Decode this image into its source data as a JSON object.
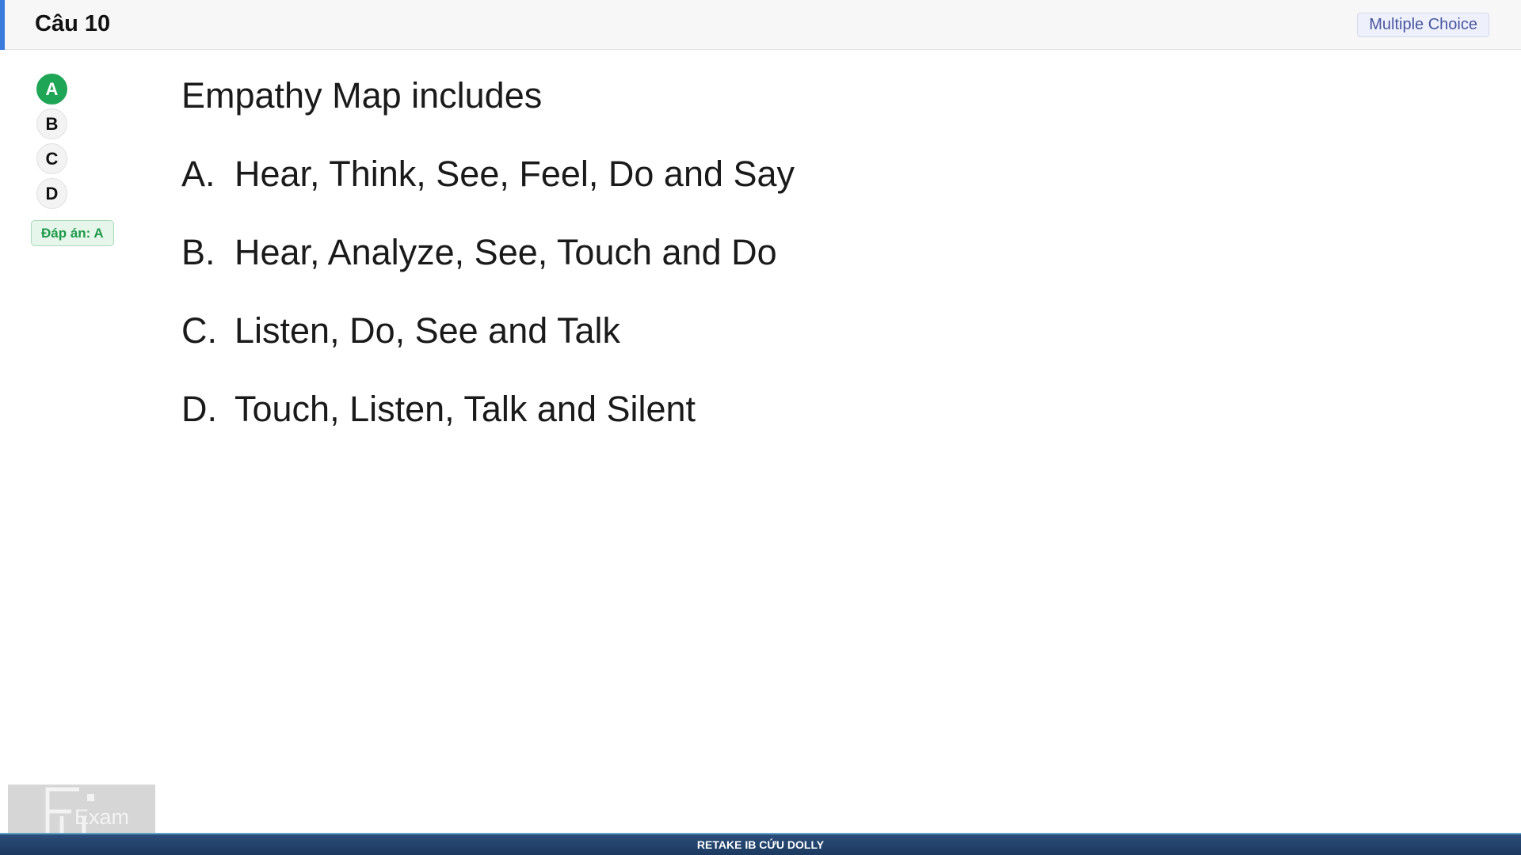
{
  "header": {
    "question_title": "Câu 10",
    "type_badge": "Multiple Choice",
    "accent_color": "#3b7bdc"
  },
  "answer_options": [
    {
      "label": "A",
      "selected": true
    },
    {
      "label": "B",
      "selected": false
    },
    {
      "label": "C",
      "selected": false
    },
    {
      "label": "D",
      "selected": false
    }
  ],
  "answer_badge": "Đáp án: A",
  "question": {
    "stem": "Empathy Map includes",
    "choices": [
      {
        "letter": "A.",
        "text": "Hear, Think, See, Feel, Do and Say"
      },
      {
        "letter": "B.",
        "text": "Hear, Analyze, See, Touch and Do"
      },
      {
        "letter": "C.",
        "text": "Listen, Do, See and Talk"
      },
      {
        "letter": "D.",
        "text": "Touch, Listen, Talk and Silent"
      }
    ]
  },
  "logo": {
    "text": "Exam"
  },
  "footer": {
    "text": "RETAKE IB CỨU DOLLY"
  },
  "colors": {
    "selected": "#1ea656",
    "footer_bg": "#1c3a60"
  }
}
